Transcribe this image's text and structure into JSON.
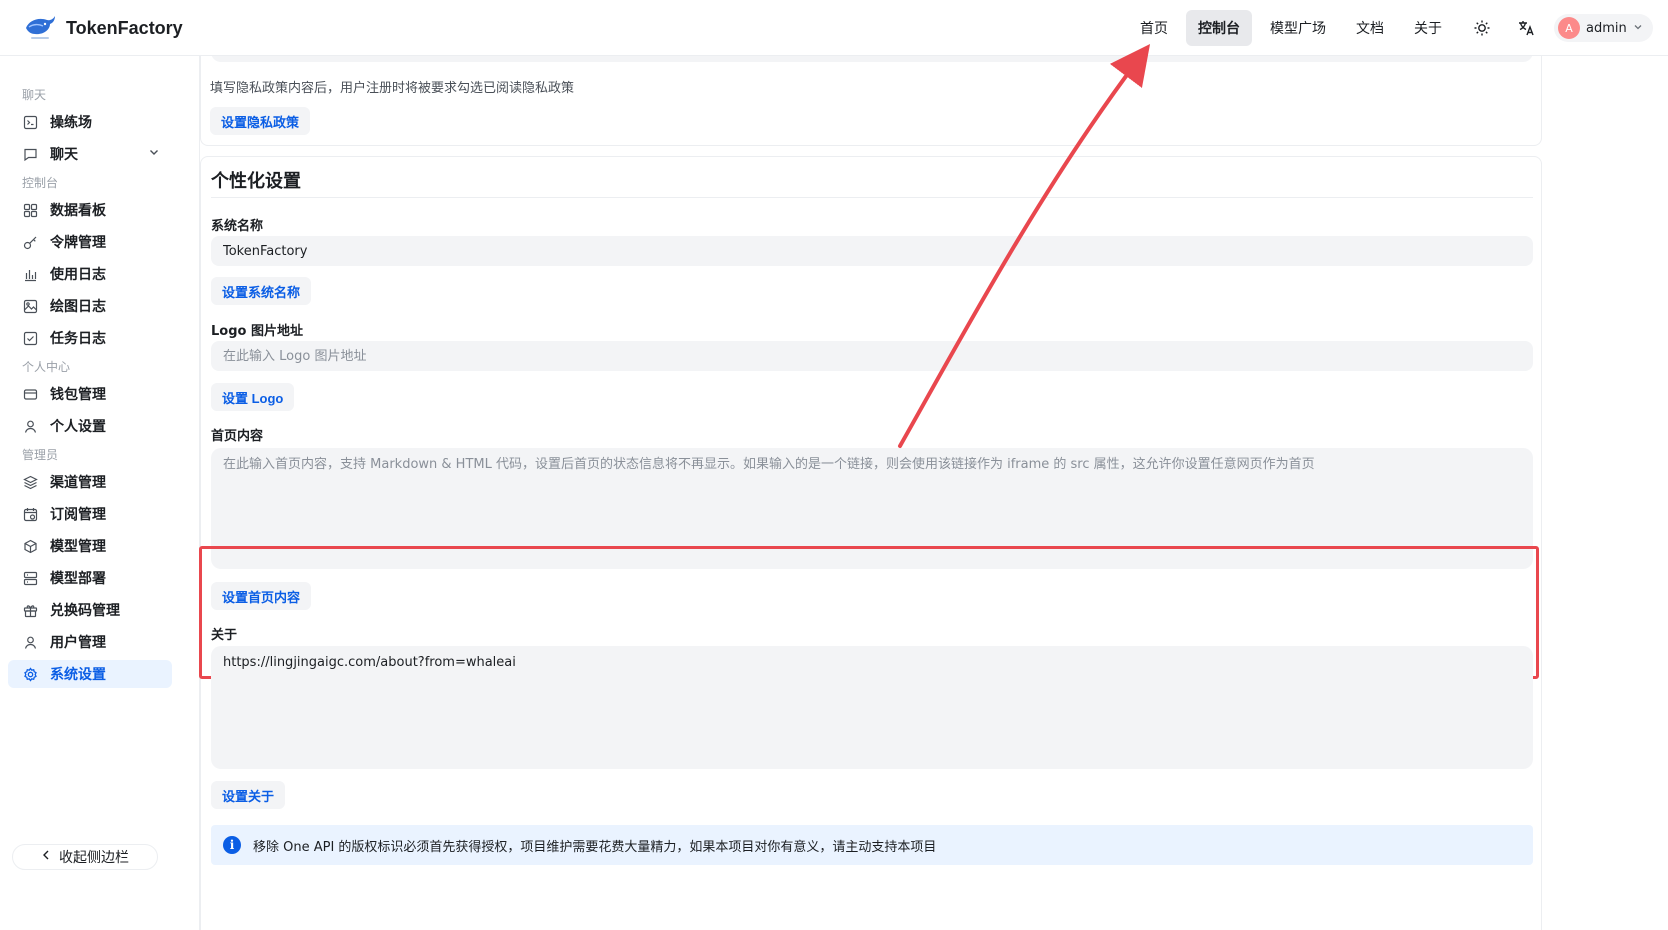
{
  "app": {
    "brand_name": "TokenFactory"
  },
  "header": {
    "nav": [
      {
        "label": "首页",
        "active": false
      },
      {
        "label": "控制台",
        "active": true
      },
      {
        "label": "模型广场",
        "active": false
      },
      {
        "label": "文档",
        "active": false
      },
      {
        "label": "关于",
        "active": false
      }
    ],
    "user": {
      "avatar_letter": "A",
      "name": "admin"
    }
  },
  "sidebar": {
    "groups": [
      {
        "title": "聊天",
        "items": [
          {
            "label": "操练场",
            "icon": "terminal-icon"
          },
          {
            "label": "聊天",
            "icon": "chat-bubble-icon",
            "expandable": true
          }
        ]
      },
      {
        "title": "控制台",
        "items": [
          {
            "label": "数据看板",
            "icon": "dashboard-grid-icon"
          },
          {
            "label": "令牌管理",
            "icon": "key-icon"
          },
          {
            "label": "使用日志",
            "icon": "bar-chart-icon"
          },
          {
            "label": "绘图日志",
            "icon": "image-icon"
          },
          {
            "label": "任务日志",
            "icon": "checkbox-icon"
          }
        ]
      },
      {
        "title": "个人中心",
        "items": [
          {
            "label": "钱包管理",
            "icon": "wallet-card-icon"
          },
          {
            "label": "个人设置",
            "icon": "user-icon"
          }
        ]
      },
      {
        "title": "管理员",
        "items": [
          {
            "label": "渠道管理",
            "icon": "layers-icon"
          },
          {
            "label": "订阅管理",
            "icon": "calendar-clock-icon"
          },
          {
            "label": "模型管理",
            "icon": "cube-icon"
          },
          {
            "label": "模型部署",
            "icon": "server-icon"
          },
          {
            "label": "兑换码管理",
            "icon": "gift-icon"
          },
          {
            "label": "用户管理",
            "icon": "user-icon"
          },
          {
            "label": "系统设置",
            "icon": "gear-icon",
            "active": true
          }
        ]
      }
    ],
    "collapse_label": "收起侧边栏"
  },
  "privacy": {
    "hint": "填写隐私政策内容后，用户注册时将被要求勾选已阅读隐私政策",
    "button": "设置隐私政策"
  },
  "personalization": {
    "title": "个性化设置",
    "system_name": {
      "label": "系统名称",
      "value": "TokenFactory",
      "button": "设置系统名称"
    },
    "logo": {
      "label": "Logo 图片地址",
      "placeholder": "在此输入 Logo 图片地址",
      "button": "设置 Logo"
    },
    "home": {
      "label": "首页内容",
      "placeholder": "在此输入首页内容，支持 Markdown & HTML 代码，设置后首页的状态信息将不再显示。如果输入的是一个链接，则会使用该链接作为 iframe 的 src 属性，这允许你设置任意网页作为首页",
      "button": "设置首页内容"
    },
    "about": {
      "label": "关于",
      "value": "https://lingjingaigc.com/about?from=whaleai",
      "button": "设置关于"
    },
    "notice": "移除 One API 的版权标识必须首先获得授权，项目维护需要花费大量精力，如果本项目对你有意义，请主动支持本项目"
  },
  "colors": {
    "accent": "#0b5ee5",
    "highlight": "#e9474e",
    "active_bg": "#eaf3ff"
  }
}
